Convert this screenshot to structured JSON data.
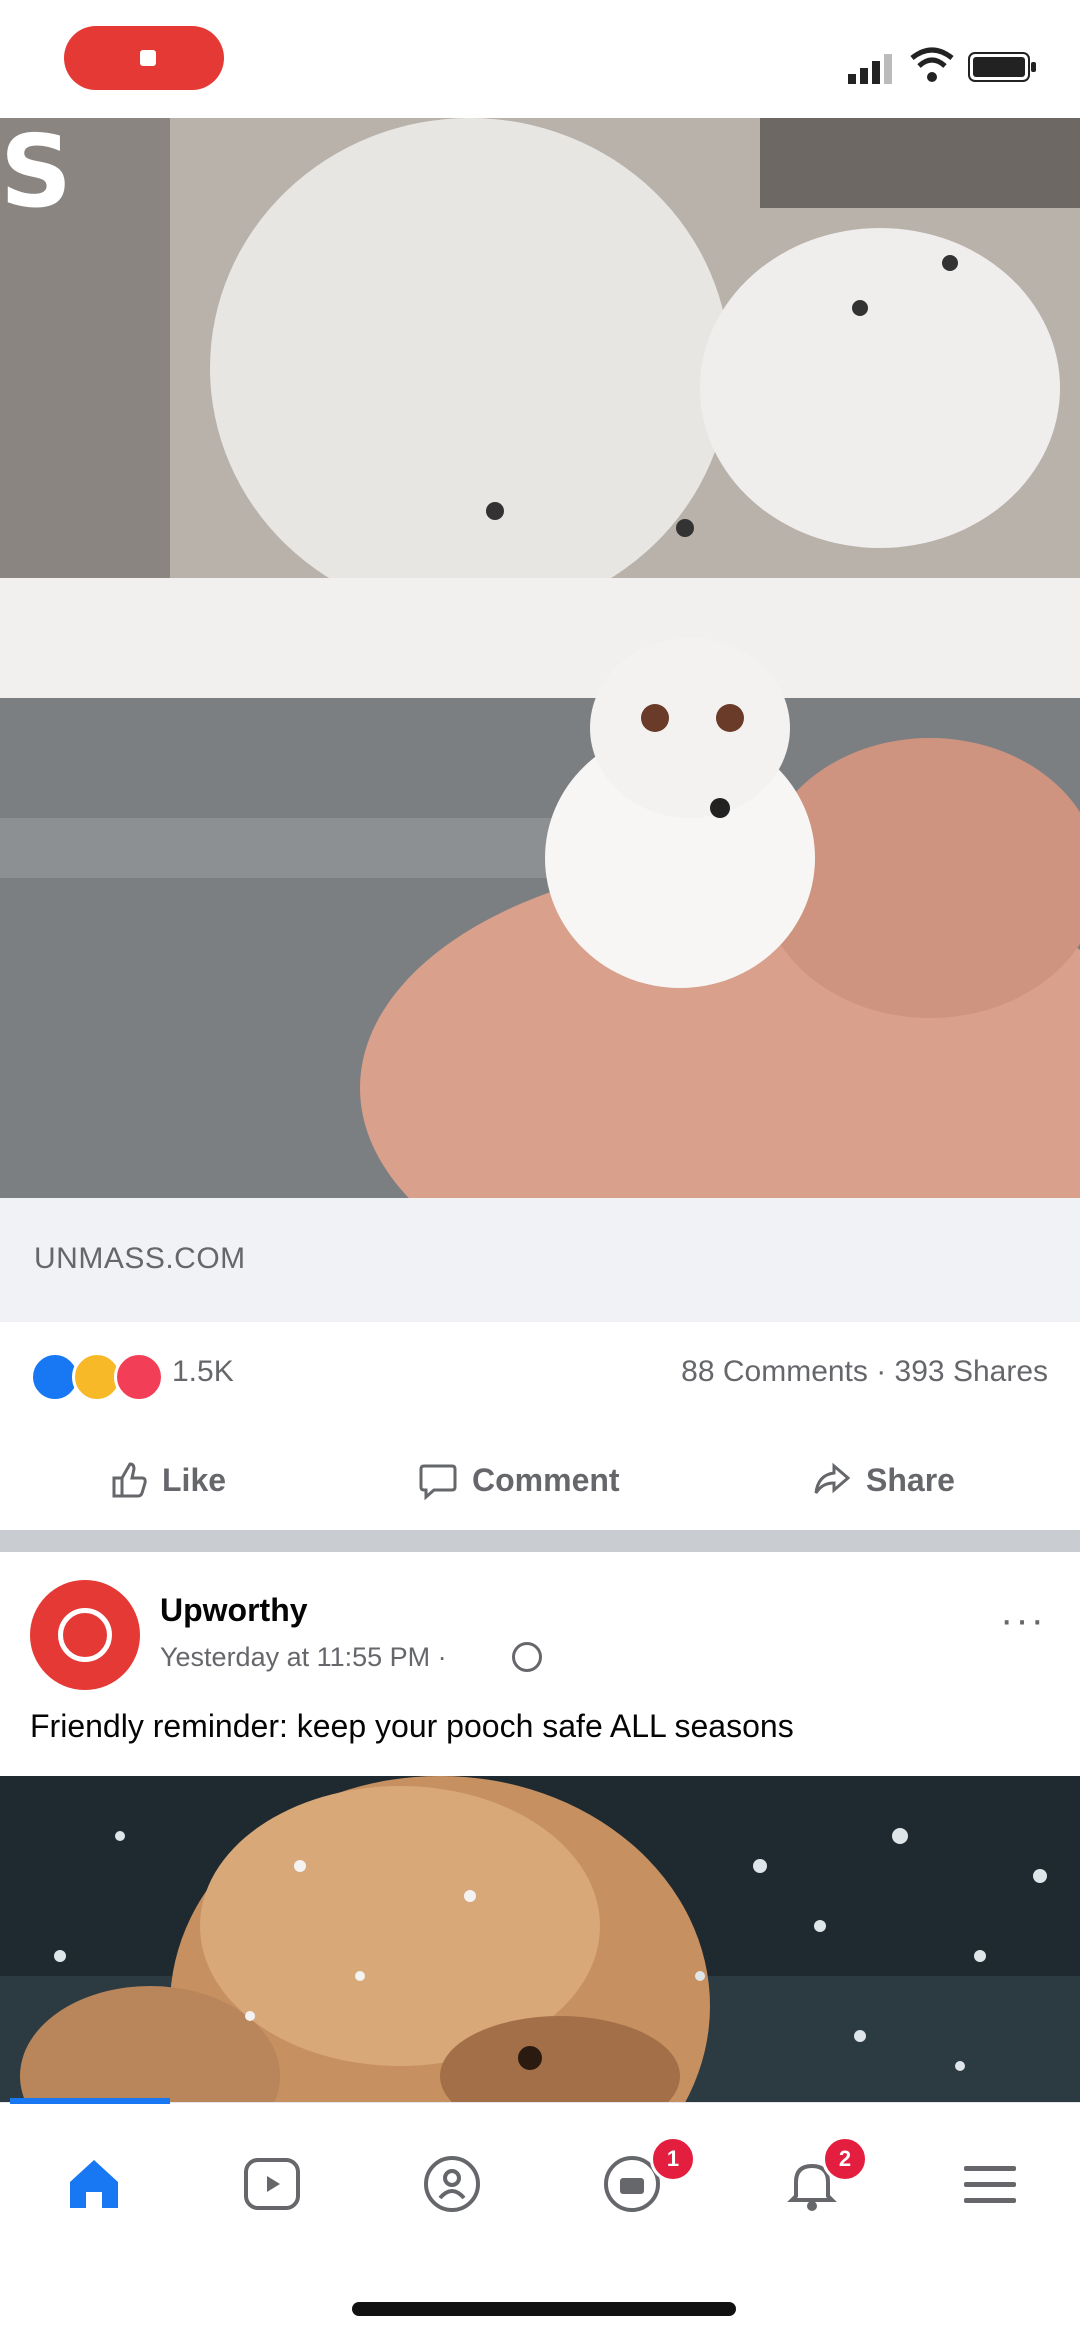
{
  "feed": {
    "video_post": {
      "link_domain": "UNMASS.COM",
      "reaction_count": "1.5K",
      "comments_shares": "88 Comments · 393 Shares",
      "actions": {
        "like": "Like",
        "comment": "Comment",
        "share": "Share"
      }
    },
    "photo_post": {
      "page_name": "Upworthy",
      "timestamp": "Yesterday at 11:55 PM ·",
      "caption": "Friendly reminder: keep your pooch safe ALL seasons",
      "more": "···"
    }
  },
  "bottom_nav": {
    "items": [
      "home-icon",
      "watch-icon",
      "groups-icon",
      "marketplace-icon",
      "notifications-icon",
      "menu-icon"
    ],
    "marketplace_badge": "1",
    "notifications_badge": "2"
  },
  "colors": {
    "accent": "#1877f2",
    "badge": "#e41e3f",
    "record": "#e53935"
  }
}
